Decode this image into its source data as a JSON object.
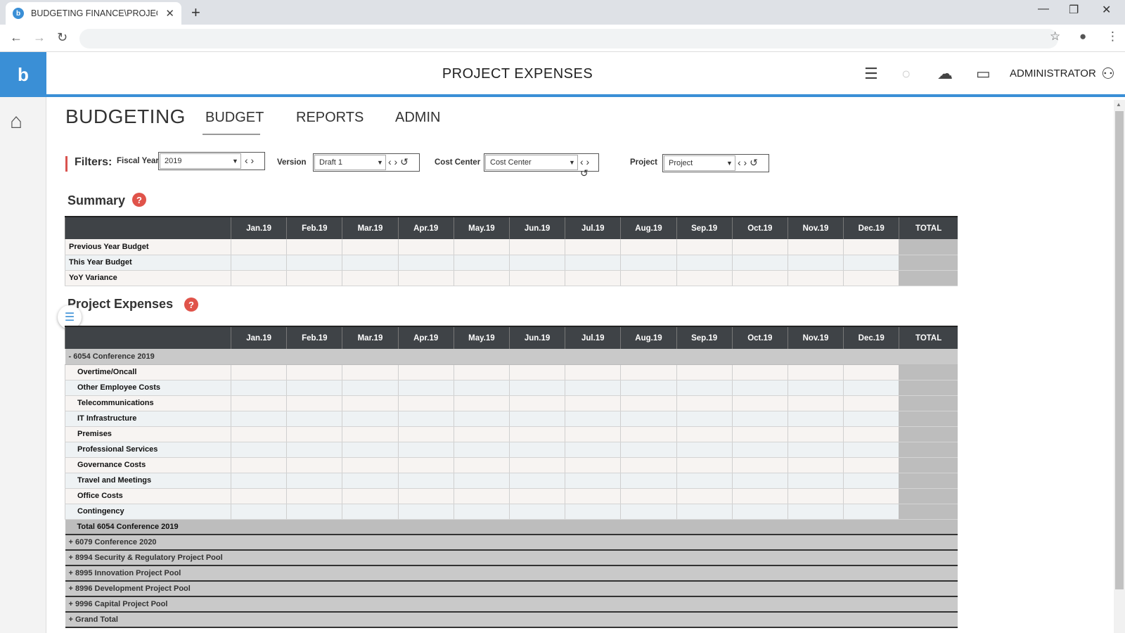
{
  "browser": {
    "tab_title": "BUDGETING FINANCE\\PROJECT E",
    "favicon_letter": "b",
    "close_glyph": "✕",
    "new_tab_glyph": "+"
  },
  "header": {
    "logo": "b",
    "title": "PROJECT EXPENSES",
    "user": "ADMINISTRATOR"
  },
  "nav": {
    "brand": "BUDGETING",
    "tabs": [
      "BUDGET",
      "REPORTS",
      "ADMIN"
    ],
    "active_tab": "BUDGET"
  },
  "filters": {
    "label": "Filters:",
    "fiscal_year": {
      "label": "Fiscal Year",
      "value": "2019"
    },
    "version": {
      "label": "Version",
      "value": "Draft 1"
    },
    "cost_center": {
      "label": "Cost Center",
      "value": "Cost Center"
    },
    "project": {
      "label": "Project",
      "value": "Project"
    }
  },
  "summary": {
    "title": "Summary",
    "help": "?",
    "columns": [
      "Jan.19",
      "Feb.19",
      "Mar.19",
      "Apr.19",
      "May.19",
      "Jun.19",
      "Jul.19",
      "Aug.19",
      "Sep.19",
      "Oct.19",
      "Nov.19",
      "Dec.19",
      "TOTAL"
    ],
    "rows": [
      "Previous Year Budget",
      "This Year Budget",
      "YoY Variance"
    ]
  },
  "expenses": {
    "title": "Project Expenses",
    "help": "?",
    "columns": [
      "Jan.19",
      "Feb.19",
      "Mar.19",
      "Apr.19",
      "May.19",
      "Jun.19",
      "Jul.19",
      "Aug.19",
      "Sep.19",
      "Oct.19",
      "Nov.19",
      "Dec.19",
      "TOTAL"
    ],
    "open_group": "- 6054 Conference 2019",
    "lines": [
      "Overtime/Oncall",
      "Other Employee Costs",
      "Telecommunications",
      "IT Infrastructure",
      "Premises",
      "Professional Services",
      "Governance Costs",
      "Travel and Meetings",
      "Office Costs",
      "Contingency"
    ],
    "group_total": "Total 6054 Conference 2019",
    "collapsed_groups": [
      "+ 6079 Conference 2020",
      "+ 8994 Security & Regulatory Project Pool",
      "+ 8995 Innovation Project Pool",
      "+ 8996 Development Project Pool",
      "+ 9996 Capital Project Pool",
      "+ Grand Total"
    ]
  },
  "icons": {
    "back": "back-arrow-icon",
    "forward": "forward-arrow-icon",
    "reload": "reload-icon",
    "star": "bookmark-star-icon",
    "profile": "profile-icon",
    "menu": "kebab-menu-icon",
    "hamburger": "hamburger-icon",
    "status": "status-circle-icon",
    "cloud": "cloud-icon",
    "chat": "chat-icon",
    "user": "user-icon",
    "home": "home-icon"
  },
  "colors": {
    "accent": "#3a8fd6",
    "help": "#e0534a",
    "header_dark": "#3f4347"
  }
}
